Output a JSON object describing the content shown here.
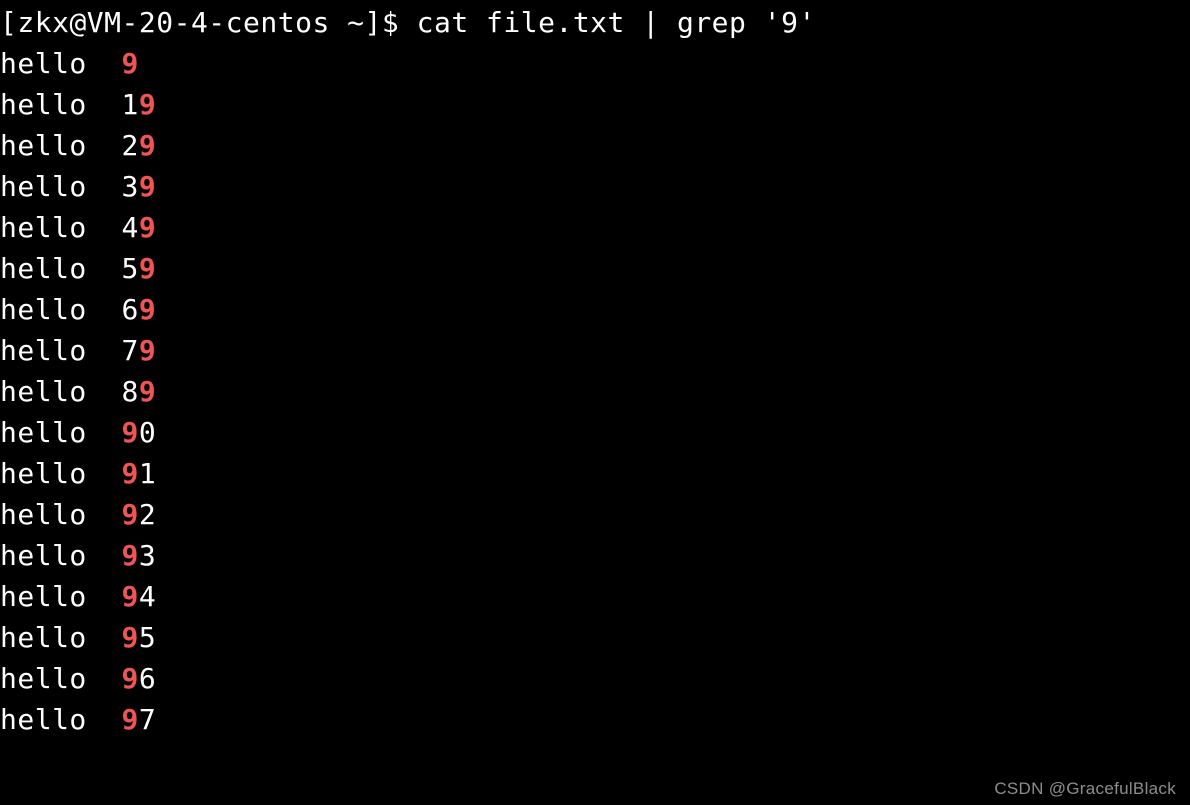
{
  "prompt": {
    "user": "zkx",
    "host": "VM-20-4-centos",
    "cwd": "~",
    "symbol": "$",
    "command": "cat file.txt | grep '9'"
  },
  "lines": [
    {
      "word": "hello",
      "pre": "",
      "match": "9",
      "post": ""
    },
    {
      "word": "hello",
      "pre": "1",
      "match": "9",
      "post": ""
    },
    {
      "word": "hello",
      "pre": "2",
      "match": "9",
      "post": ""
    },
    {
      "word": "hello",
      "pre": "3",
      "match": "9",
      "post": ""
    },
    {
      "word": "hello",
      "pre": "4",
      "match": "9",
      "post": ""
    },
    {
      "word": "hello",
      "pre": "5",
      "match": "9",
      "post": ""
    },
    {
      "word": "hello",
      "pre": "6",
      "match": "9",
      "post": ""
    },
    {
      "word": "hello",
      "pre": "7",
      "match": "9",
      "post": ""
    },
    {
      "word": "hello",
      "pre": "8",
      "match": "9",
      "post": ""
    },
    {
      "word": "hello",
      "pre": "",
      "match": "9",
      "post": "0"
    },
    {
      "word": "hello",
      "pre": "",
      "match": "9",
      "post": "1"
    },
    {
      "word": "hello",
      "pre": "",
      "match": "9",
      "post": "2"
    },
    {
      "word": "hello",
      "pre": "",
      "match": "9",
      "post": "3"
    },
    {
      "word": "hello",
      "pre": "",
      "match": "9",
      "post": "4"
    },
    {
      "word": "hello",
      "pre": "",
      "match": "9",
      "post": "5"
    },
    {
      "word": "hello",
      "pre": "",
      "match": "9",
      "post": "6"
    },
    {
      "word": "hello",
      "pre": "",
      "match": "9",
      "post": "7"
    }
  ],
  "watermark": "CSDN @GracefulBlack",
  "colors": {
    "bg": "#000000",
    "fg": "#ffffff",
    "match": "#f15454"
  }
}
